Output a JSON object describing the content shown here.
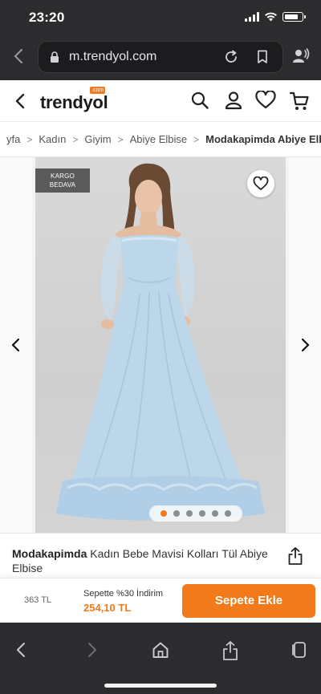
{
  "status_bar": {
    "time": "23:20",
    "battery_level": 0.8
  },
  "browser": {
    "url": "m.trendyol.com"
  },
  "site": {
    "logo_text": "trendyol",
    "logo_badge": ".com"
  },
  "breadcrumb": {
    "items": [
      "yfa",
      "Kadın",
      "Giyim",
      "Abiye Elbise",
      "Modakapimda Abiye Elbise"
    ],
    "separator": ">"
  },
  "gallery": {
    "badge_line1": "KARGO",
    "badge_line2": "BEDAVA",
    "image_count": 6,
    "active_index": 0
  },
  "product": {
    "brand": "Modakapimda",
    "name": "Kadın Bebe Mavisi Kolları Tül Abiye Elbise"
  },
  "buy_bar": {
    "old_price": "363 TL",
    "promo_label": "Sepette %30 İndirim",
    "promo_price": "254,10 TL",
    "add_button": "Sepete Ekle"
  },
  "colors": {
    "brand_orange": "#f27a1a",
    "chrome_dark": "#2c2c2e",
    "dress_blue": "#bcd6ea"
  },
  "icons": [
    "back-chevron-icon",
    "lock-icon",
    "reload-icon",
    "bookmark-icon",
    "profile-voice-icon",
    "search-icon",
    "user-icon",
    "heart-icon",
    "cart-icon",
    "share-icon",
    "forward-icon",
    "home-icon",
    "tabs-icon"
  ]
}
